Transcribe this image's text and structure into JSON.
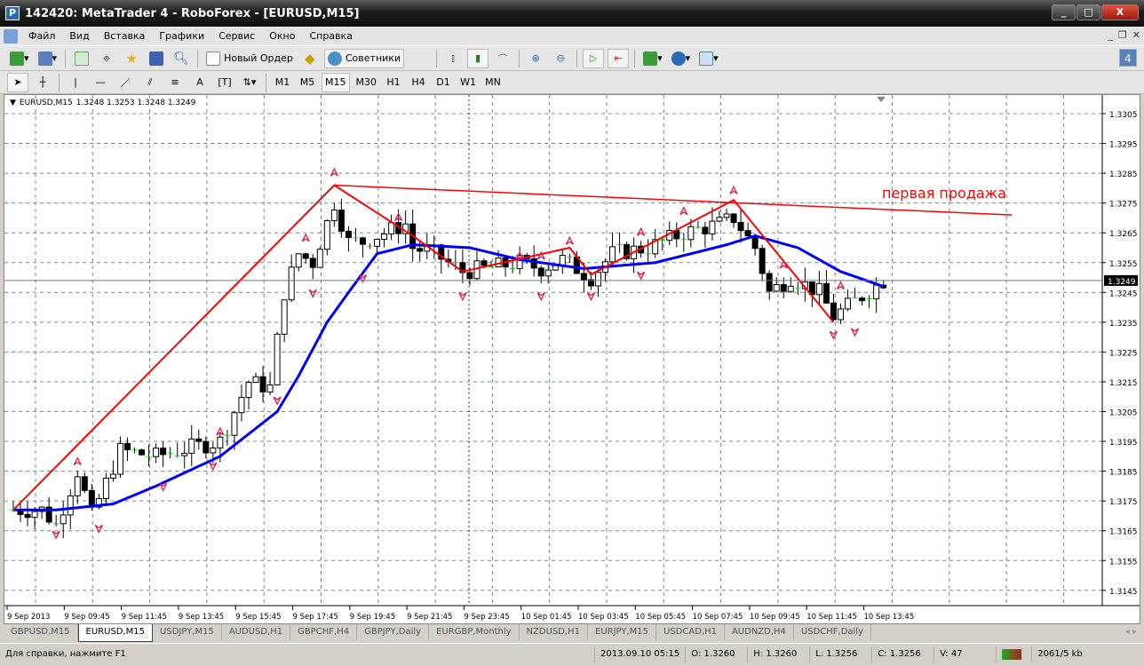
{
  "window": {
    "title": "142420: MetaTrader 4 - RoboForex - [EURUSD,M15]",
    "logo": "P"
  },
  "menu": [
    "Файл",
    "Вид",
    "Вставка",
    "Графики",
    "Сервис",
    "Окно",
    "Справка"
  ],
  "toolbar": {
    "new_order": "Новый Ордер",
    "experts": "Советники",
    "notifications": "4"
  },
  "timeframes": [
    "M1",
    "M5",
    "M15",
    "M30",
    "H1",
    "H4",
    "D1",
    "W1",
    "MN"
  ],
  "active_timeframe": "M15",
  "chart": {
    "symbol_label": "EURUSD,M15",
    "ohlc": "1.3248 1.3253 1.3248 1.3249",
    "current_price": "1.3249",
    "annotation": "первая продажа",
    "price_ticks": [
      "1.3305",
      "1.3295",
      "1.3285",
      "1.3275",
      "1.3265",
      "1.3255",
      "1.3245",
      "1.3235",
      "1.3225",
      "1.3215",
      "1.3205",
      "1.3195",
      "1.3185",
      "1.3175",
      "1.3165",
      "1.3155",
      "1.3145"
    ],
    "time_ticks": [
      "9 Sep 2013",
      "9 Sep 09:45",
      "9 Sep 11:45",
      "9 Sep 13:45",
      "9 Sep 15:45",
      "9 Sep 17:45",
      "9 Sep 19:45",
      "9 Sep 21:45",
      "9 Sep 23:45",
      "10 Sep 01:45",
      "10 Sep 03:45",
      "10 Sep 05:45",
      "10 Sep 07:45",
      "10 Sep 09:45",
      "10 Sep 11:45",
      "10 Sep 13:45"
    ],
    "price_path": [
      [
        0,
        1.3172
      ],
      [
        4,
        1.3172
      ],
      [
        6,
        1.3167
      ],
      [
        9,
        1.3185
      ],
      [
        11,
        1.317
      ],
      [
        15,
        1.3192
      ],
      [
        20,
        1.319
      ],
      [
        25,
        1.3193
      ],
      [
        29,
        1.3195
      ],
      [
        31,
        1.3205
      ],
      [
        33,
        1.3215
      ],
      [
        36,
        1.3213
      ],
      [
        38,
        1.3245
      ],
      [
        40,
        1.3258
      ],
      [
        42,
        1.3255
      ],
      [
        45,
        1.3275
      ],
      [
        47,
        1.3262
      ],
      [
        49,
        1.3262
      ],
      [
        53,
        1.3266
      ],
      [
        55,
        1.3268
      ],
      [
        56,
        1.326
      ],
      [
        59,
        1.3258
      ],
      [
        63,
        1.3252
      ],
      [
        66,
        1.3253
      ],
      [
        71,
        1.3255
      ],
      [
        74,
        1.3253
      ],
      [
        77,
        1.3256
      ],
      [
        81,
        1.325
      ],
      [
        84,
        1.3258
      ],
      [
        89,
        1.326
      ],
      [
        94,
        1.3265
      ],
      [
        99,
        1.3268
      ],
      [
        101,
        1.327
      ],
      [
        104,
        1.326
      ],
      [
        106,
        1.3245
      ],
      [
        109,
        1.325
      ],
      [
        113,
        1.3245
      ],
      [
        115,
        1.3237
      ],
      [
        118,
        1.3242
      ],
      [
        122,
        1.3249
      ]
    ],
    "zigzag": [
      [
        0,
        1.3172
      ],
      [
        45,
        1.3281
      ],
      [
        56,
        1.3264
      ],
      [
        63,
        1.3252
      ],
      [
        78,
        1.326
      ],
      [
        81,
        1.3251
      ],
      [
        101,
        1.3276
      ],
      [
        115,
        1.3235
      ]
    ],
    "trendline": [
      [
        45,
        1.3281
      ],
      [
        140,
        1.3271
      ]
    ],
    "ma": [
      [
        0,
        1.3172
      ],
      [
        6,
        1.3172
      ],
      [
        14,
        1.3174
      ],
      [
        20,
        1.318
      ],
      [
        29,
        1.319
      ],
      [
        37,
        1.3205
      ],
      [
        40,
        1.3217
      ],
      [
        44,
        1.3235
      ],
      [
        47,
        1.3245
      ],
      [
        51,
        1.3258
      ],
      [
        56,
        1.3261
      ],
      [
        64,
        1.326
      ],
      [
        71,
        1.3256
      ],
      [
        80,
        1.3253
      ],
      [
        90,
        1.3255
      ],
      [
        100,
        1.3261
      ],
      [
        104,
        1.3264
      ],
      [
        110,
        1.326
      ],
      [
        116,
        1.3252
      ],
      [
        122,
        1.3247
      ]
    ],
    "fractals_up": [
      [
        9,
        1.3188
      ],
      [
        29,
        1.3198
      ],
      [
        45,
        1.3285
      ],
      [
        41,
        1.3263
      ],
      [
        54,
        1.327
      ],
      [
        71,
        1.3257
      ],
      [
        74,
        1.3257
      ],
      [
        78,
        1.3262
      ],
      [
        88,
        1.3265
      ],
      [
        94,
        1.3272
      ],
      [
        101,
        1.3279
      ],
      [
        108,
        1.3254
      ],
      [
        116,
        1.3247
      ]
    ],
    "fractals_down": [
      [
        6,
        1.3164
      ],
      [
        12,
        1.3166
      ],
      [
        21,
        1.318
      ],
      [
        28,
        1.3187
      ],
      [
        37,
        1.3209
      ],
      [
        42,
        1.3245
      ],
      [
        49,
        1.325
      ],
      [
        63,
        1.3244
      ],
      [
        74,
        1.3244
      ],
      [
        81,
        1.3244
      ],
      [
        88,
        1.3251
      ],
      [
        115,
        1.3231
      ],
      [
        118,
        1.3232
      ]
    ],
    "colors": {
      "zigzag": "#ff0000",
      "ma": "#0000ff",
      "annotation": "#ff0000",
      "grid": "#7a8595"
    }
  },
  "tabs": [
    "GBPUSD,M15",
    "EURUSD,M15",
    "USDJPY,M15",
    "AUDUSD,H1",
    "GBPCHF,H4",
    "GBPJPY,Daily",
    "EURGBP,Monthly",
    "NZDUSD,H1",
    "EURJPY,M15",
    "USDCAD,H1",
    "AUDNZD,H4",
    "USDCHF,Daily"
  ],
  "active_tab": "EURUSD,M15",
  "status": {
    "help": "Для справки, нажмите F1",
    "datetime": "2013.09.10 05:15",
    "open": "O: 1.3260",
    "high": "H: 1.3260",
    "low": "L: 1.3256",
    "close": "C: 1.3256",
    "volume": "V: 47",
    "traffic": "2061/5 kb"
  }
}
